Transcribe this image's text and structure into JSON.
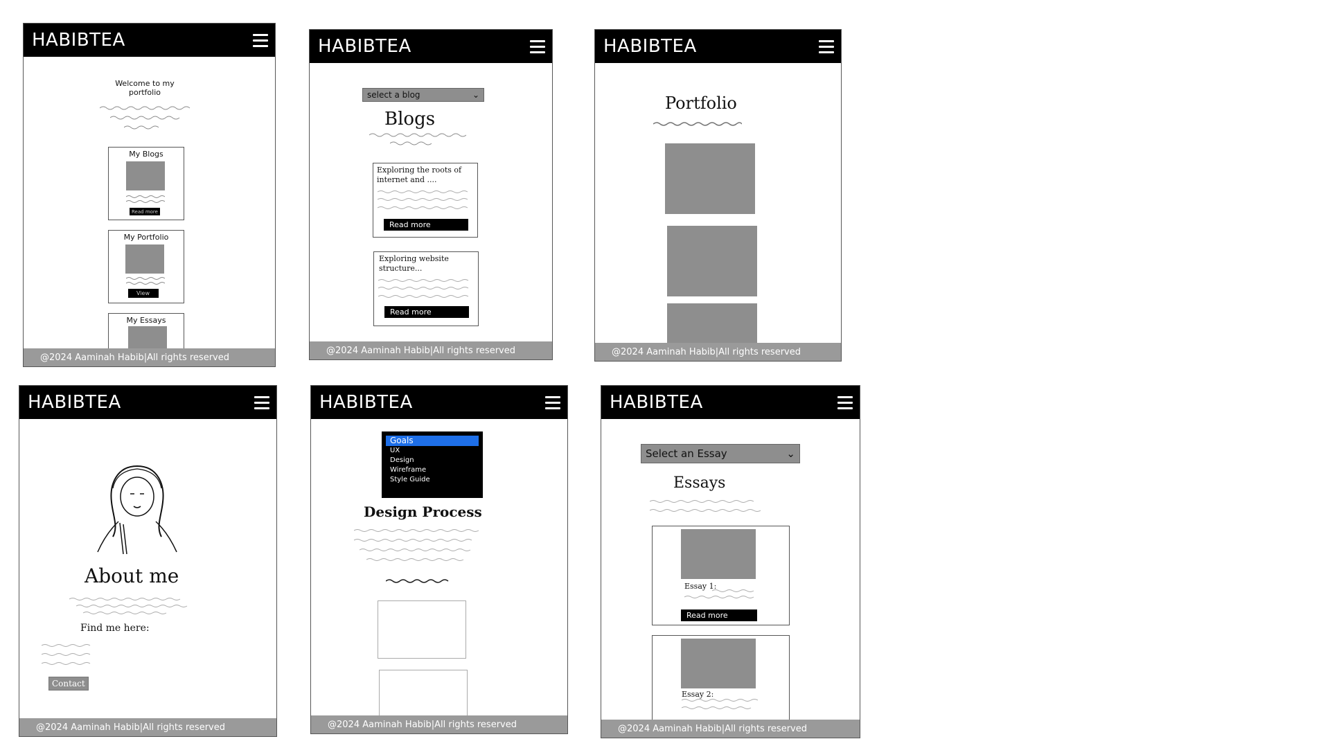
{
  "brand": "HABIBTEA",
  "footer": "@2024 Aaminah Habib|All rights reserved",
  "home": {
    "welcome": "Welcome to my portfolio",
    "cards": [
      {
        "title": "My Blogs",
        "button": "Read more"
      },
      {
        "title": "My Portfolio",
        "button": "View"
      },
      {
        "title": "My Essays"
      }
    ]
  },
  "blogs": {
    "select": "select a blog",
    "heading": "Blogs",
    "posts": [
      {
        "title": "Exploring the roots of internet and ....",
        "button": "Read more"
      },
      {
        "title": "Exploring website structure...",
        "button": "Read more"
      }
    ]
  },
  "portfolio": {
    "heading": "Portfolio"
  },
  "about": {
    "heading": "About me",
    "find": "Find me here:",
    "contact": "Contact"
  },
  "design": {
    "options": [
      "Goals",
      "UX",
      "Design",
      "Wireframe",
      "Style Guide"
    ],
    "heading": "Design Process"
  },
  "essays": {
    "select": "Select an Essay",
    "heading": "Essays",
    "items": [
      {
        "label": "Essay 1:",
        "button": "Read more"
      },
      {
        "label": "Essay 2:"
      }
    ]
  },
  "colors": {
    "header": "#000000",
    "footer": "#9a9a9a",
    "placeholder": "#8e8e8e",
    "selected_option": "#1e6fe8"
  }
}
